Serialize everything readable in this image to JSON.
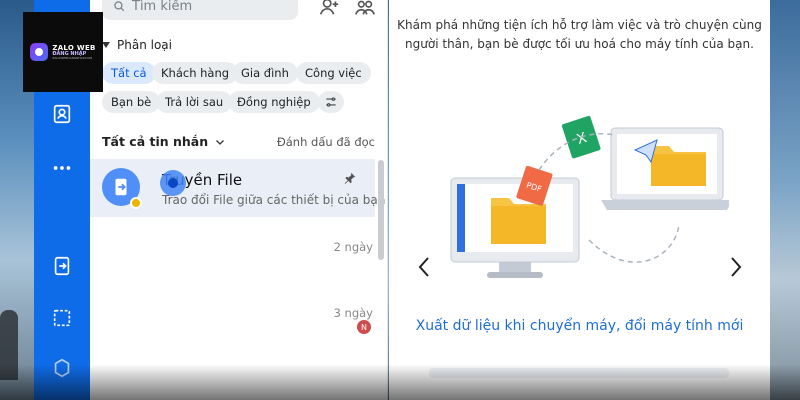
{
  "logo": {
    "line1": "ZALO WEB",
    "line2": "ĐĂNG NHẬP",
    "line3": "ZALOWEBDANGNHAP.COM"
  },
  "search": {
    "placeholder": "Tìm kiếm"
  },
  "sidebar": {
    "items": [
      {
        "icon": "contacts-icon"
      },
      {
        "icon": "more-icon"
      },
      {
        "icon": "transfer-icon"
      },
      {
        "icon": "screenshot-icon"
      },
      {
        "icon": "settings-icon"
      }
    ]
  },
  "categories": {
    "title": "Phân loại",
    "chips": [
      {
        "label": "Tất cả",
        "active": true
      },
      {
        "label": "Khách hàng"
      },
      {
        "label": "Gia đình"
      },
      {
        "label": "Công việc"
      },
      {
        "label": "Bạn bè"
      },
      {
        "label": "Trả lời sau"
      },
      {
        "label": "Đồng nghiệp"
      }
    ]
  },
  "inbox": {
    "filter": "Tất cả tin nhắn",
    "mark_read": "Đánh dấu đã đọc",
    "conversations": [
      {
        "name": "Truyền File",
        "preview": "Trao đổi File giữa các thiết bị của bạn",
        "pinned": true
      },
      {
        "time": "2 ngày"
      },
      {
        "time": "3 ngày",
        "badge": "N"
      }
    ]
  },
  "welcome": {
    "intro": "Khám phá những tiện ích hỗ trợ làm việc và trò chuyện cùng người thân, bạn bè được tối ưu hoá cho máy tính của bạn.",
    "slide_title": "Xuất dữ liệu khi chuyển máy, đổi máy tính mới",
    "pdf_label": "PDF"
  },
  "colors": {
    "brand_blue": "#0f6ce8",
    "chip_active": "#dbe9ff",
    "title_blue": "#1f6dd6"
  }
}
